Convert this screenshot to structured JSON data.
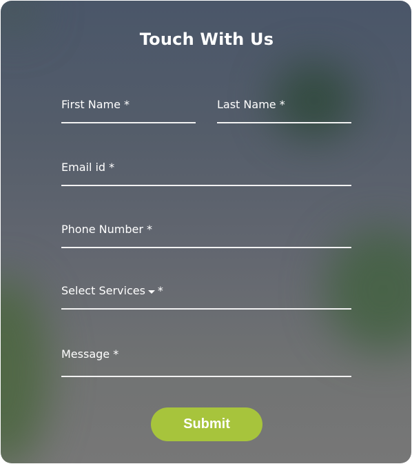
{
  "form": {
    "title": "Touch With Us",
    "fields": {
      "first_name": {
        "label": "First Name *"
      },
      "last_name": {
        "label": "Last Name *"
      },
      "email": {
        "label": "Email id *"
      },
      "phone": {
        "label": "Phone Number *"
      },
      "services": {
        "label": "Select Services",
        "required_mark": "*",
        "icon": "caret-down-icon"
      },
      "message": {
        "label": "Message *"
      }
    },
    "submit_label": "Submit"
  },
  "colors": {
    "accent": "#a7c43c",
    "text": "#ffffff",
    "underline": "#f2f2f2"
  }
}
